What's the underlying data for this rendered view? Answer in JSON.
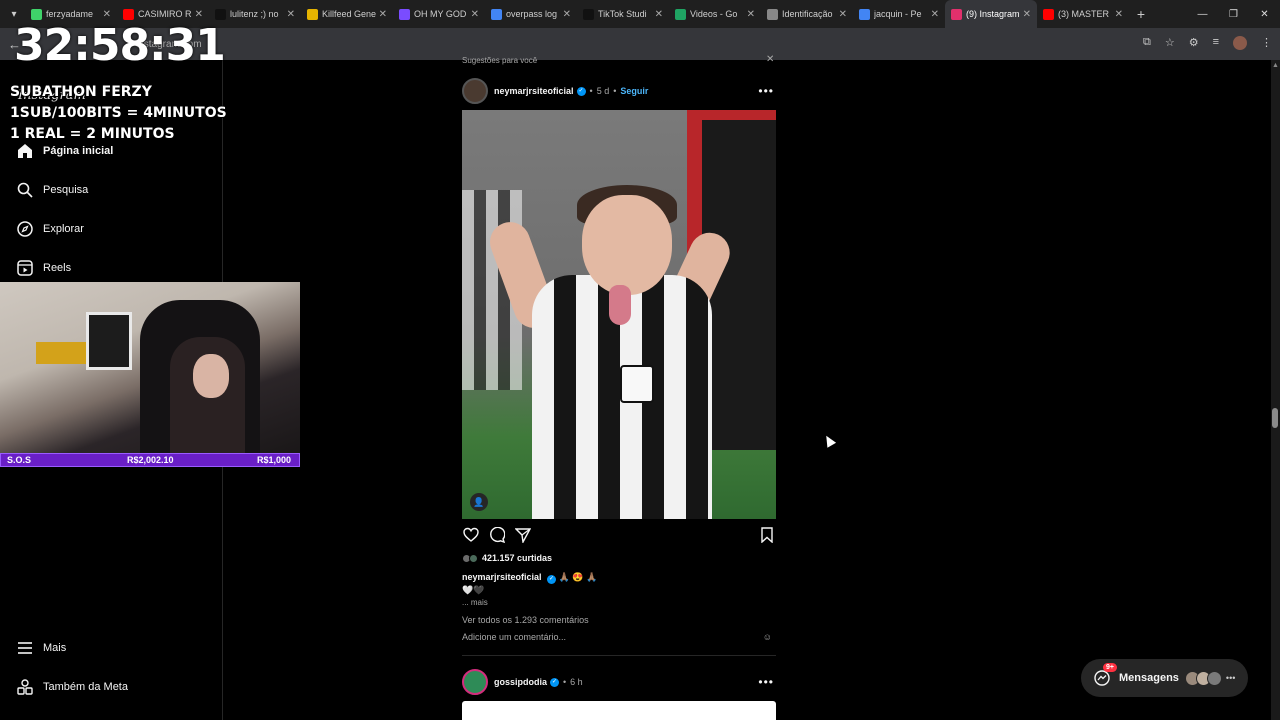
{
  "browser": {
    "tabs": [
      {
        "label": "ferzyadame",
        "color": "#3fd36a",
        "active": false
      },
      {
        "label": "CASIMIRO R",
        "color": "#ff0000",
        "active": false
      },
      {
        "label": "lulitenz ;) no",
        "color": "#111111",
        "active": false
      },
      {
        "label": "Killfeed Gene",
        "color": "#e6b400",
        "active": false
      },
      {
        "label": "OH MY GOD",
        "color": "#7a4cff",
        "active": false
      },
      {
        "label": "overpass log",
        "color": "#4285f4",
        "active": false
      },
      {
        "label": "TikTok Studi",
        "color": "#111111",
        "active": false
      },
      {
        "label": "Videos - Go",
        "color": "#1fa463",
        "active": false
      },
      {
        "label": "Identificação",
        "color": "#888888",
        "active": false
      },
      {
        "label": "jacquin - Pe",
        "color": "#4285f4",
        "active": false
      },
      {
        "label": "(9) Instagram",
        "color": "#e1306c",
        "active": true
      },
      {
        "label": "(3) MASTER",
        "color": "#ff0000",
        "active": false
      }
    ],
    "url": "instagram.com"
  },
  "stream_overlay": {
    "timer": "32:58:31",
    "line1": "SUBATHON FERZY",
    "line2": "1SUB/100BITS = 4MINUTOS",
    "line3": "1 REAL = 2 MINUTOS",
    "goal_left": "S.O.S",
    "goal_mid": "R$2,002.10",
    "goal_right": "R$1,000"
  },
  "sidebar": {
    "logo": "Instagram",
    "items": [
      {
        "label": "Página inicial",
        "icon": "home-icon"
      },
      {
        "label": "Pesquisa",
        "icon": "search-icon"
      },
      {
        "label": "Explorar",
        "icon": "compass-icon"
      },
      {
        "label": "Reels",
        "icon": "reels-icon"
      }
    ],
    "bottom": [
      {
        "label": "Mais",
        "icon": "menu-icon"
      },
      {
        "label": "Também da Meta",
        "icon": "meta-icon"
      }
    ]
  },
  "feed": {
    "section": "Sugestões para você",
    "post1": {
      "user": "neymarjrsiteoficial",
      "time": "5 d",
      "follow": "Seguir",
      "likes": "421.157 curtidas",
      "caption_user": "neymarjrsiteoficial",
      "caption_emojis": "🙏🏽 😍 🙏🏽",
      "hearts": "🤍🖤",
      "more": "... mais",
      "comments": "Ver todos os 1.293 comentários",
      "add_comment": "Adicione um comentário..."
    },
    "post2": {
      "user": "gossipdodia",
      "time": "6 h"
    }
  },
  "messages": {
    "label": "Mensagens",
    "badge": "9+"
  }
}
